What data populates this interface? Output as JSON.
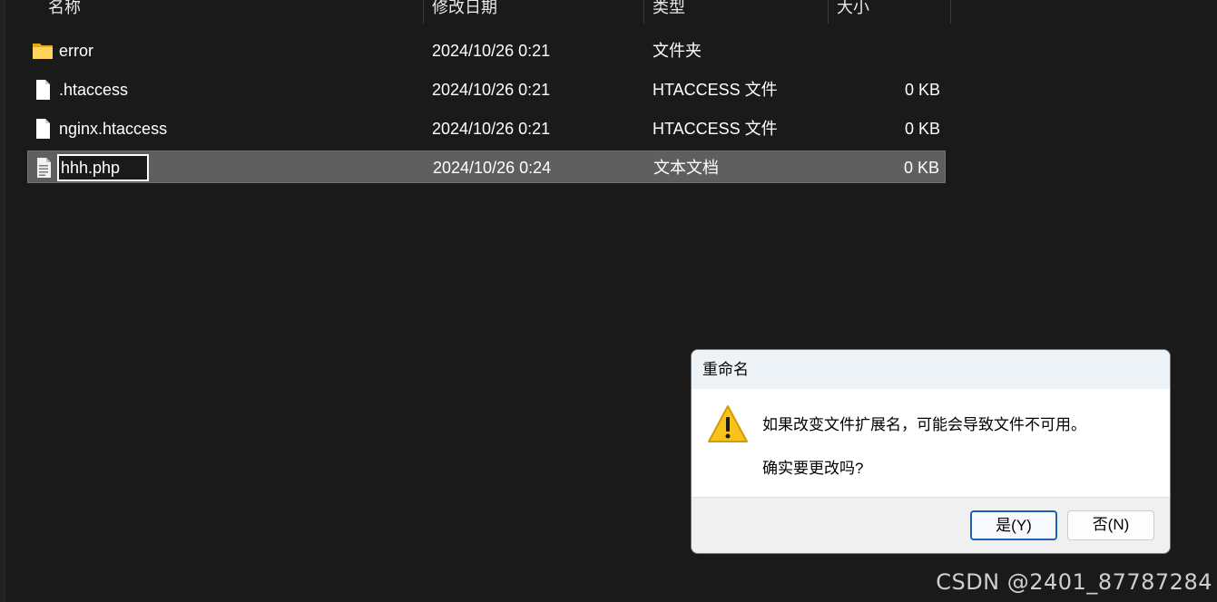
{
  "columns": {
    "name": "名称",
    "modified": "修改日期",
    "type": "类型",
    "size": "大小"
  },
  "files": [
    {
      "name": "error",
      "modified": "2024/10/26 0:21",
      "type": "文件夹",
      "size": "",
      "icon": "folder-icon"
    },
    {
      "name": ".htaccess",
      "modified": "2024/10/26 0:21",
      "type": "HTACCESS 文件",
      "size": "0 KB",
      "icon": "file-icon"
    },
    {
      "name": "nginx.htaccess",
      "modified": "2024/10/26 0:21",
      "type": "HTACCESS 文件",
      "size": "0 KB",
      "icon": "file-icon"
    },
    {
      "name": "hhh.php",
      "modified": "2024/10/26 0:24",
      "type": "文本文档",
      "size": "0 KB",
      "icon": "text-file-icon"
    }
  ],
  "dialog": {
    "title": "重命名",
    "message": "如果改变文件扩展名，可能会导致文件不可用。",
    "question": "确实要更改吗?",
    "yes_label": "是(Y)",
    "no_label": "否(N)",
    "icon": "warning-icon"
  },
  "watermark": "CSDN @2401_87787284",
  "colors": {
    "background": "#1a1a1a",
    "selected_row": "#5f5f5f",
    "folder": "#f4c542",
    "warning": "#f7c31b",
    "primary_button_border": "#1f5fb5"
  }
}
